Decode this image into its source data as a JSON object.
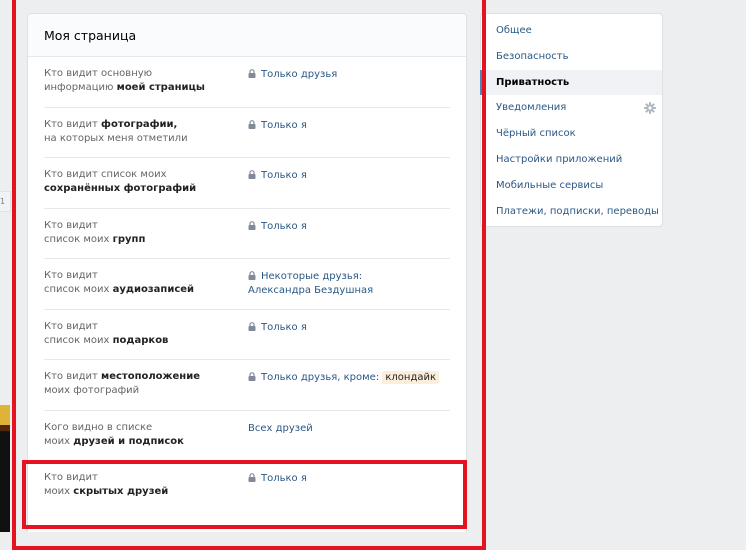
{
  "edge_tab_text": "1",
  "main": {
    "title": "Моя страница",
    "rows": [
      {
        "q_pre": "Кто видит основную",
        "q_line2_pre": "информацию ",
        "q_bold": "моей страницы",
        "answer": "Только друзья",
        "lock": true
      },
      {
        "q_pre": "Кто видит ",
        "q_bold1": "фотографии,",
        "q_line2": "на которых меня отметили",
        "answer": "Только я",
        "lock": true
      },
      {
        "q_pre": "Кто видит список моих",
        "q_bold": "сохранённых фотографий",
        "answer": "Только я",
        "lock": true
      },
      {
        "q_pre": "Кто видит",
        "q_line2_pre": "список моих ",
        "q_bold": "групп",
        "answer": "Только я",
        "lock": true
      },
      {
        "q_pre": "Кто видит",
        "q_line2_pre": "список моих ",
        "q_bold": "аудиозаписей",
        "answer": "Некоторые друзья:",
        "answer_line2": "Александра Бездушная",
        "lock": true
      },
      {
        "q_pre": "Кто видит",
        "q_line2_pre": "список моих ",
        "q_bold": "подарков",
        "answer": "Только я",
        "lock": true
      },
      {
        "q_pre": "Кто видит ",
        "q_bold1": "местоположение",
        "q_line2": "моих фотографий",
        "answer": "Только друзья, кроме:",
        "answer_tag": "клондайк",
        "lock": true
      },
      {
        "q_pre": "Кого видно в списке",
        "q_line2_pre": "моих ",
        "q_bold": "друзей и подписок",
        "answer": "Всех друзей",
        "lock": false
      },
      {
        "q_pre": "Кто видит",
        "q_line2_pre": "моих ",
        "q_bold": "скрытых друзей",
        "answer": "Только я",
        "lock": true
      }
    ]
  },
  "menu": {
    "items": [
      {
        "label": "Общее"
      },
      {
        "label": "Безопасность"
      },
      {
        "label": "Приватность",
        "active": true
      },
      {
        "label": "Уведомления",
        "icon": "gear-icon"
      },
      {
        "label": "Чёрный список"
      },
      {
        "label": "Настройки приложений"
      },
      {
        "label": "Мобильные сервисы"
      },
      {
        "label": "Платежи, подписки, переводы"
      }
    ]
  },
  "colors": {
    "link": "#2a5885",
    "highlight_frame": "#e4131f",
    "tag_bg": "#fbeedb"
  }
}
